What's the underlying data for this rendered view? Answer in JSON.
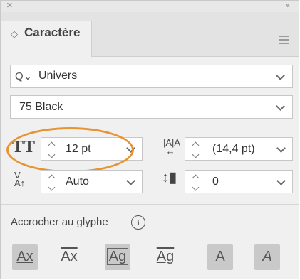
{
  "window": {
    "close_glyph": "×",
    "collapse_glyph": "‹‹"
  },
  "tab": {
    "label": "Caractère",
    "arrows_glyph": "◇"
  },
  "font_family": {
    "value": "Univers",
    "search_glyph": "Q⌄"
  },
  "font_style": {
    "value": "75 Black"
  },
  "size": {
    "icon_text": "TT",
    "value": "12 pt"
  },
  "leading": {
    "value": "(14,4 pt)"
  },
  "kerning": {
    "value": "Auto"
  },
  "tracking": {
    "value": "0"
  },
  "snap": {
    "label": "Accrocher au glyphe",
    "info_glyph": "i"
  },
  "glyph_buttons": [
    {
      "glyph": "Ax",
      "active": true
    },
    {
      "glyph": "Ax",
      "active": false
    },
    {
      "glyph": "Ag",
      "active": true
    },
    {
      "glyph": "Ag",
      "active": false
    },
    {
      "glyph": "A",
      "active": true
    },
    {
      "glyph": "A",
      "active": true
    }
  ],
  "colors": {
    "highlight_oval": "#e89433",
    "panel_bg": "#f0f0f0"
  }
}
